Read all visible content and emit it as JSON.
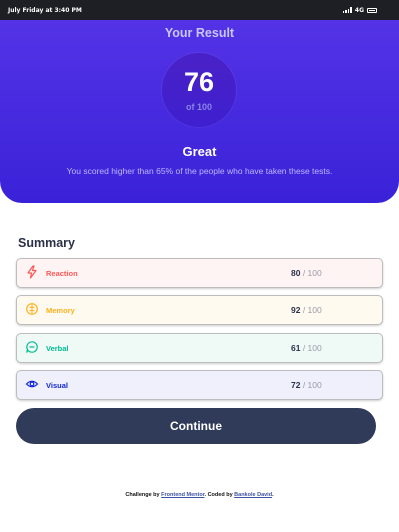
{
  "status_bar": {
    "time_text": "July Friday at 3:40 PM",
    "network": "4G"
  },
  "result": {
    "title": "Your Result",
    "score": "76",
    "score_of": "of 100",
    "grade": "Great",
    "description": "You scored higher than 65% of the people who have taken these tests."
  },
  "summary": {
    "title": "Summary",
    "items": [
      {
        "label": "Reaction",
        "score": "80",
        "out_of": " / 100",
        "color": "#ff5757",
        "icon": "lightning-icon"
      },
      {
        "label": "Memory",
        "score": "92",
        "out_of": " / 100",
        "color": "#ffb21e",
        "icon": "brain-icon"
      },
      {
        "label": "Verbal",
        "score": "61",
        "out_of": " / 100",
        "color": "#00bb8f",
        "icon": "speech-bubble-icon"
      },
      {
        "label": "Visual",
        "score": "72",
        "out_of": " / 100",
        "color": "#1125d6",
        "icon": "eye-icon"
      }
    ],
    "continue_label": "Continue"
  },
  "attribution": {
    "prefix": "Challenge by ",
    "challenge_link": "Frontend Mentor",
    "middle": ". Coded by ",
    "author_link": "Bankole David",
    "suffix": "."
  },
  "colors": {
    "gradient_top": "#5433e6",
    "gradient_bottom": "#3a22d8",
    "button": "#303b59"
  }
}
